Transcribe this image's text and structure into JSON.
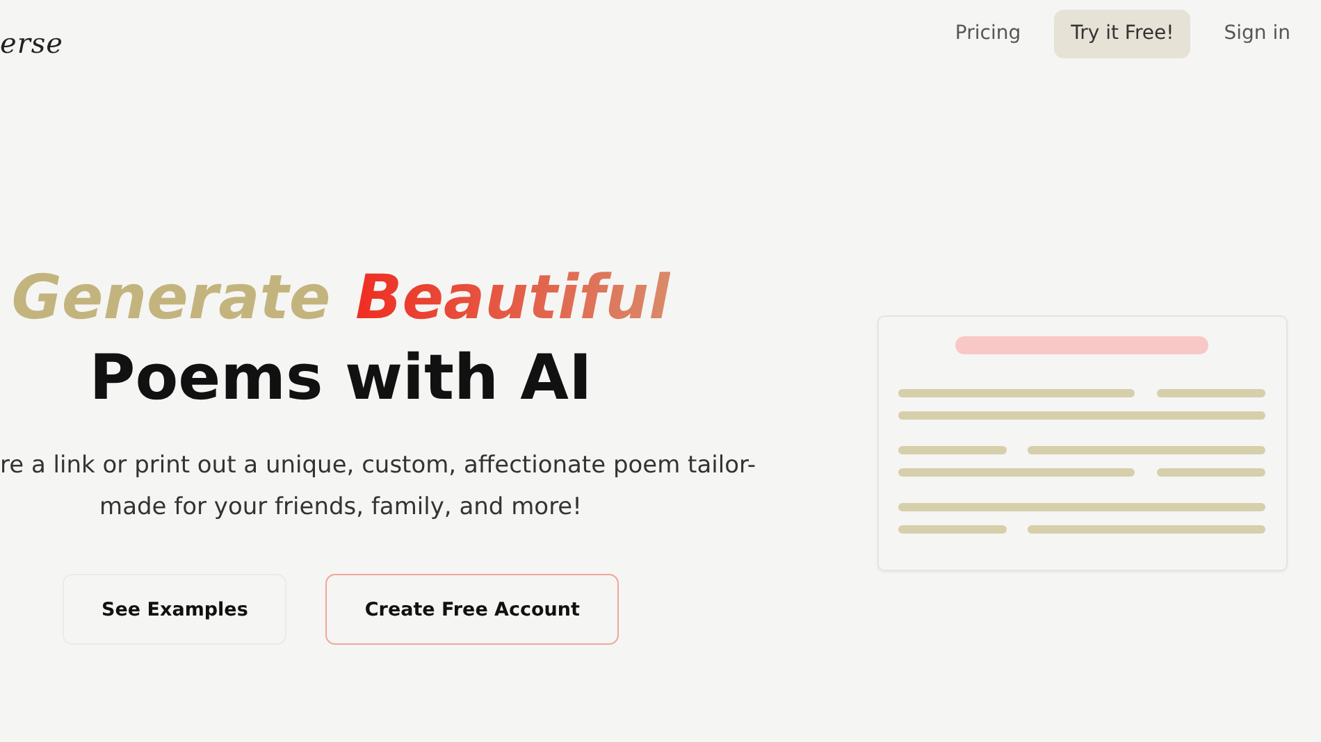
{
  "header": {
    "logo": "erse",
    "nav": [
      {
        "label": "Pricing",
        "kind": "link"
      },
      {
        "label": "Try it Free!",
        "kind": "button"
      },
      {
        "label": "Sign in",
        "kind": "link"
      }
    ]
  },
  "hero": {
    "headline": {
      "lead": "Generate",
      "accent": "Beautiful",
      "second_line": "Poems with AI"
    },
    "description": [
      "re a link or print out a unique, custom, affectionate poem tailor-",
      "made for your friends, family, and more!"
    ],
    "buttons": [
      {
        "label": "See Examples",
        "kind": "plain"
      },
      {
        "label": "Create Free Account",
        "kind": "outlined"
      }
    ]
  }
}
